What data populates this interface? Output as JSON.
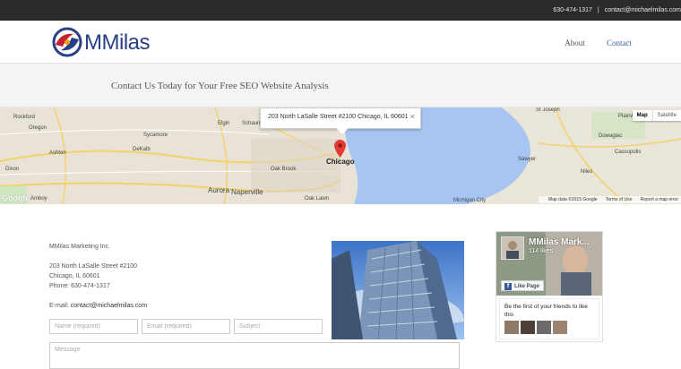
{
  "topbar": {
    "phone": "630-474-1317",
    "separator": "|",
    "email": "contact@michaelmilas.com"
  },
  "header": {
    "logo_text": "MMilas",
    "nav": [
      {
        "label": "About",
        "active": false
      },
      {
        "label": "Contact",
        "active": true
      }
    ]
  },
  "banner": {
    "title": "Contact Us Today for Your Free SEO Website Analysis"
  },
  "map": {
    "infowindow_address": "203 North LaSalle Street #2100 Chicago, IL 60601",
    "close_glyph": "×",
    "map_type": [
      "Map",
      "Satellite"
    ],
    "labels": [
      "Rockford",
      "Oregon",
      "Dixon",
      "Amboy",
      "Sycamore",
      "DeKalb",
      "Ashton",
      "Elgin",
      "Schaumburg",
      "Aurora",
      "Naperville",
      "Oak Brook",
      "Oak Lawn",
      "Chicago",
      "St Joseph",
      "Dowagiac",
      "Cassopolis",
      "Sawyer",
      "Niles",
      "Michigan City",
      "Plainwell"
    ],
    "footer": [
      "Map data ©2015 Google",
      "Terms of Use",
      "Report a map error"
    ],
    "google": "Google"
  },
  "contact_info": {
    "company": "MMilas Marketing Inc.",
    "street": "203 North LaSalle Street #2100",
    "city": "Chicago, IL 60601",
    "phone_label": "Phone: 630-474-1317",
    "email_label": "E-mail:",
    "email": "contact@michaelmilas.com"
  },
  "form": {
    "name_placeholder": "Name (required)",
    "email_placeholder": "Email (required)",
    "subject_placeholder": "Subject",
    "message_placeholder": "Message"
  },
  "facebook": {
    "page_name": "MMilas Mark...",
    "likes": "114 likes",
    "like_button": "Like Page",
    "friends_text": "Be the first of your friends to like this"
  },
  "colors": {
    "accent": "#3a5ca8",
    "topbar": "#2b2b2b",
    "logo": "#2a3f85",
    "map_water": "#a7c5f2",
    "fb_blue": "#3b5998"
  }
}
